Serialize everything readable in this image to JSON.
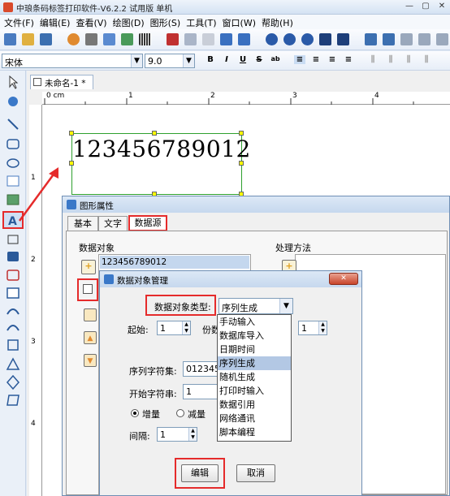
{
  "app": {
    "title": "中琅条码标签打印软件-V6.2.2 试用版 单机"
  },
  "menu": [
    "文件(F)",
    "编辑(E)",
    "查看(V)",
    "绘图(D)",
    "图形(S)",
    "工具(T)",
    "窗口(W)",
    "帮助(H)"
  ],
  "fontbar": {
    "font": "宋体",
    "size": "9.0",
    "bold": "B",
    "italic": "I",
    "underline": "U",
    "strike": "S"
  },
  "document": {
    "tab": "未命名-1 *",
    "barcode_text": "123456789012"
  },
  "ruler": {
    "h": [
      "0 cm",
      "1",
      "2",
      "3",
      "4"
    ],
    "v": [
      "1",
      "2",
      "3",
      "4"
    ]
  },
  "props_dialog": {
    "title": "图形属性",
    "tabs": [
      "基本",
      "文字",
      "数据源"
    ],
    "data_objects_label": "数据对象",
    "data_item": "123456789012",
    "processing_label": "处理方法"
  },
  "mgr_dialog": {
    "title": "数据对象管理",
    "type_label": "数据对象类型:",
    "type_value": "序列生成",
    "start_label": "起始:",
    "start_value": "1",
    "copies_label": "份数",
    "copies_value": "1",
    "charset_label": "序列字符集:",
    "charset_value": "0123456",
    "startstr_label": "开始字符串:",
    "startstr_value": "1",
    "inc_label": "增量",
    "dec_label": "减量",
    "interval_label": "间隔:",
    "interval_value": "1",
    "edit_label": "编辑",
    "cancel_label": "取消"
  },
  "dropdown": {
    "options": [
      "手动输入",
      "数据库导入",
      "日期时间",
      "序列生成",
      "随机生成",
      "打印时输入",
      "数据引用",
      "网络通讯",
      "脚本编程"
    ],
    "selected": 3
  }
}
